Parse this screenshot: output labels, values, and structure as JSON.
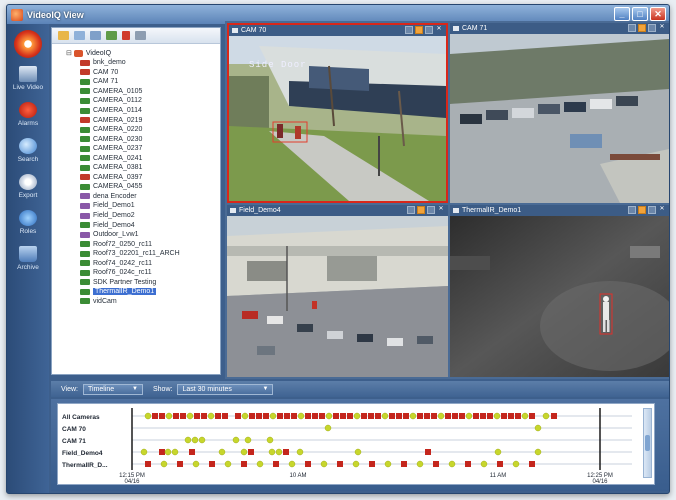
{
  "window": {
    "title": "VideoIQ View"
  },
  "nav": [
    {
      "key": "live",
      "label": "Live Video",
      "icon": "live-video-icon"
    },
    {
      "key": "alarms",
      "label": "Alarms",
      "icon": "alarm-icon"
    },
    {
      "key": "search",
      "label": "Search",
      "icon": "search-icon"
    },
    {
      "key": "export",
      "label": "Export",
      "icon": "export-icon"
    },
    {
      "key": "roles",
      "label": "Roles",
      "icon": "roles-icon"
    },
    {
      "key": "archive",
      "label": "Archive",
      "icon": "archive-icon"
    }
  ],
  "tree": {
    "root": "VideoIQ",
    "items": [
      {
        "label": "bnk_demo",
        "color": "#c23a2a"
      },
      {
        "label": "CAM 70",
        "color": "#c23a2a"
      },
      {
        "label": "CAM 71",
        "color": "#3b8c35"
      },
      {
        "label": "CAMERA_0105",
        "color": "#3b8c35"
      },
      {
        "label": "CAMERA_0112",
        "color": "#3b8c35"
      },
      {
        "label": "CAMERA_0114",
        "color": "#3b8c35"
      },
      {
        "label": "CAMERA_0219",
        "color": "#c23a2a"
      },
      {
        "label": "CAMERA_0220",
        "color": "#3b8c35"
      },
      {
        "label": "CAMERA_0230",
        "color": "#3b8c35"
      },
      {
        "label": "CAMERA_0237",
        "color": "#3b8c35"
      },
      {
        "label": "CAMERA_0241",
        "color": "#3b8c35"
      },
      {
        "label": "CAMERA_0381",
        "color": "#3b8c35"
      },
      {
        "label": "CAMERA_0397",
        "color": "#c23a2a"
      },
      {
        "label": "CAMERA_0455",
        "color": "#3b8c35"
      },
      {
        "label": "dena Encoder",
        "color": "#8a58a8"
      },
      {
        "label": "Field_Demo1",
        "color": "#8a58a8"
      },
      {
        "label": "Field_Demo2",
        "color": "#8a58a8"
      },
      {
        "label": "Field_Demo4",
        "color": "#3b8c35"
      },
      {
        "label": "Outdoor_Lvw1",
        "color": "#8a58a8"
      },
      {
        "label": "Roof72_0250_rc11",
        "color": "#3b8c35"
      },
      {
        "label": "Roof73_02201_rc11_ARCH",
        "color": "#3b8c35"
      },
      {
        "label": "Roof74_0242_rc11",
        "color": "#3b8c35"
      },
      {
        "label": "Roof76_024c_rc11",
        "color": "#3b8c35"
      },
      {
        "label": "SDK Partner Testing",
        "color": "#3b8c35"
      },
      {
        "label": "ThermalIR_Demo1",
        "color": "#3b8c35",
        "selected": true
      },
      {
        "label": "vidCam",
        "color": "#3b8c35"
      }
    ]
  },
  "tiles": [
    {
      "title": "CAM 70",
      "overlay": "Side Door",
      "active": true
    },
    {
      "title": "CAM 71",
      "overlay": "",
      "active": false
    },
    {
      "title": "Field_Demo4",
      "overlay": "",
      "active": false
    },
    {
      "title": "ThermalIR_Demo1",
      "overlay": "",
      "active": false
    }
  ],
  "controls": {
    "view_label": "View:",
    "view_value": "Timeline",
    "show_label": "Show:",
    "show_value": "Last 30 minutes"
  },
  "timeline": {
    "rows": [
      "All Cameras",
      "CAM 70",
      "CAM 71",
      "Field_Demo4",
      "ThermalIR_D..."
    ],
    "ticks": [
      {
        "time": "12:15 PM",
        "date": "04/16"
      },
      {
        "time": "10 AM",
        "date": ""
      },
      {
        "time": "11 AM",
        "date": ""
      },
      {
        "time": "12:25 PM",
        "date": "04/16"
      }
    ],
    "event_colors": {
      "alarm": "#c4261d",
      "motion": "#c7d62c"
    }
  }
}
